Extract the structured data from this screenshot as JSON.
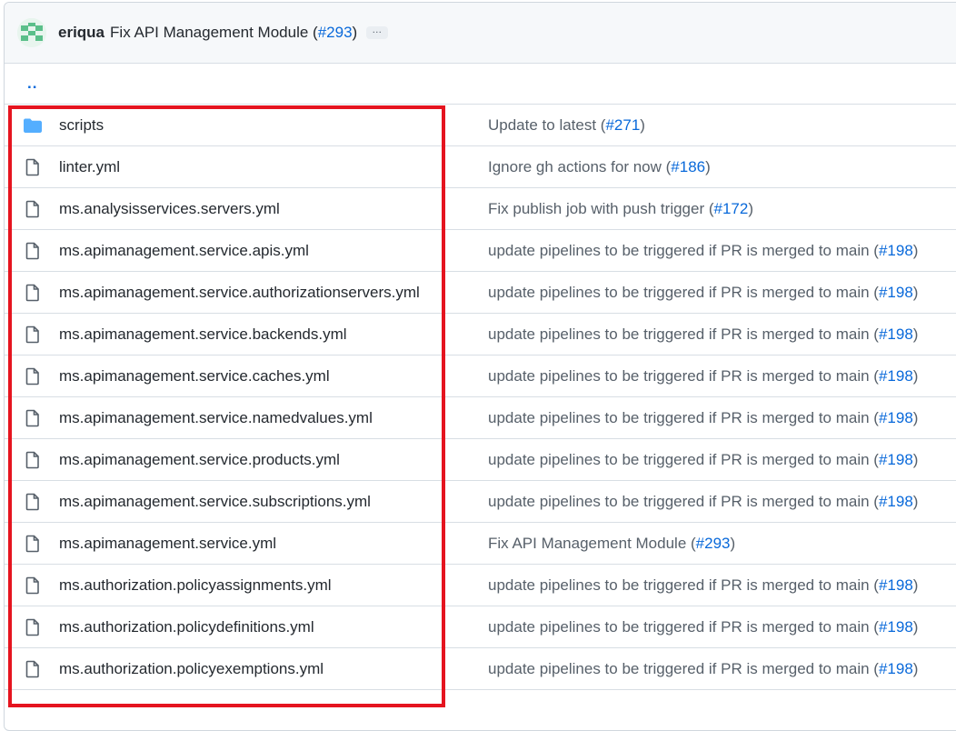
{
  "commit": {
    "author": "eriqua",
    "message": "Fix API Management Module (",
    "pr": "#293",
    "close": ")",
    "ellipsis": "…"
  },
  "parent": {
    "label": ".."
  },
  "files": [
    {
      "type": "dir",
      "name": "scripts",
      "msg": "Update to latest (",
      "pr": "#271"
    },
    {
      "type": "file",
      "name": "linter.yml",
      "msg": "Ignore gh actions for now (",
      "pr": "#186"
    },
    {
      "type": "file",
      "name": "ms.analysisservices.servers.yml",
      "msg": "Fix publish job with push trigger (",
      "pr": "#172"
    },
    {
      "type": "file",
      "name": "ms.apimanagement.service.apis.yml",
      "msg": "update pipelines to be triggered if PR is merged to main (",
      "pr": "#198"
    },
    {
      "type": "file",
      "name": "ms.apimanagement.service.authorizationservers.yml",
      "msg": "update pipelines to be triggered if PR is merged to main (",
      "pr": "#198"
    },
    {
      "type": "file",
      "name": "ms.apimanagement.service.backends.yml",
      "msg": "update pipelines to be triggered if PR is merged to main (",
      "pr": "#198"
    },
    {
      "type": "file",
      "name": "ms.apimanagement.service.caches.yml",
      "msg": "update pipelines to be triggered if PR is merged to main (",
      "pr": "#198"
    },
    {
      "type": "file",
      "name": "ms.apimanagement.service.namedvalues.yml",
      "msg": "update pipelines to be triggered if PR is merged to main (",
      "pr": "#198"
    },
    {
      "type": "file",
      "name": "ms.apimanagement.service.products.yml",
      "msg": "update pipelines to be triggered if PR is merged to main (",
      "pr": "#198"
    },
    {
      "type": "file",
      "name": "ms.apimanagement.service.subscriptions.yml",
      "msg": "update pipelines to be triggered if PR is merged to main (",
      "pr": "#198"
    },
    {
      "type": "file",
      "name": "ms.apimanagement.service.yml",
      "msg": "Fix API Management Module (",
      "pr": "#293"
    },
    {
      "type": "file",
      "name": "ms.authorization.policyassignments.yml",
      "msg": "update pipelines to be triggered if PR is merged to main (",
      "pr": "#198"
    },
    {
      "type": "file",
      "name": "ms.authorization.policydefinitions.yml",
      "msg": "update pipelines to be triggered if PR is merged to main (",
      "pr": "#198"
    },
    {
      "type": "file",
      "name": "ms.authorization.policyexemptions.yml",
      "msg": "update pipelines to be triggered if PR is merged to main (",
      "pr": "#198"
    }
  ],
  "colors": {
    "link": "#0969da",
    "folder": "#54aeff",
    "highlight": "#e5141f"
  }
}
